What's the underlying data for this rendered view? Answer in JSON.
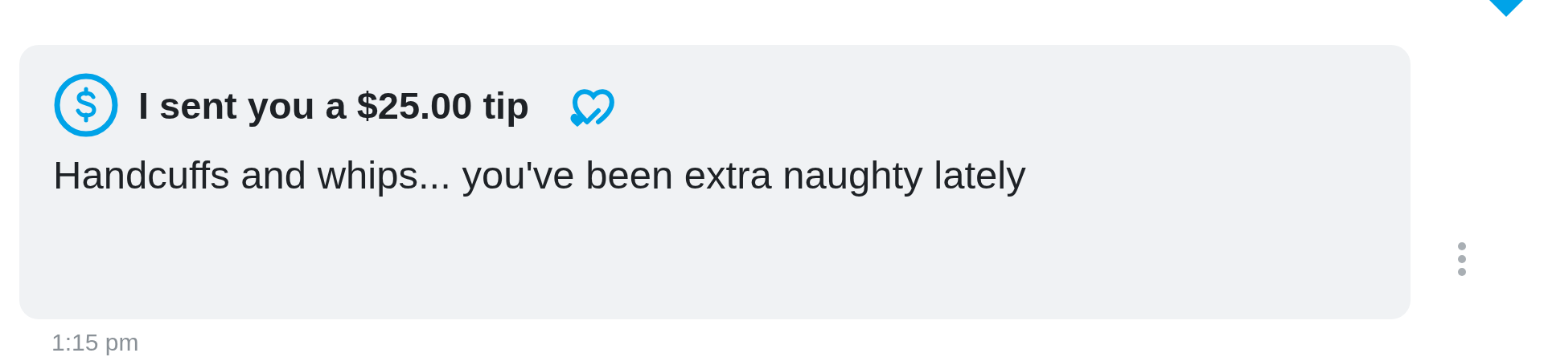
{
  "message": {
    "tip_title": "I sent you a $25.00 tip",
    "text": "Handcuffs and whips... you've been extra naughty lately",
    "time": "1:15 pm"
  }
}
